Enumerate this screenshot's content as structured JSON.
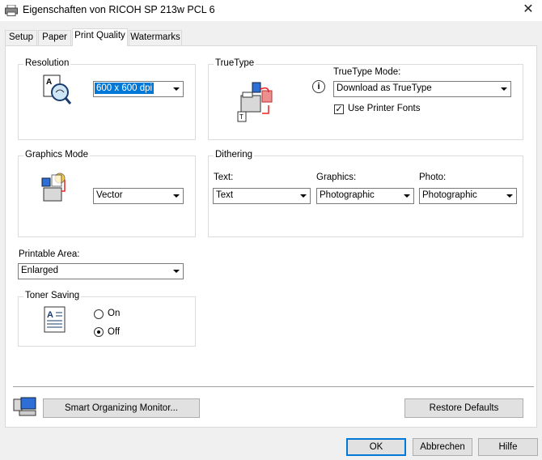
{
  "window": {
    "title": "Eigenschaften von RICOH SP 213w PCL 6",
    "close_glyph": "✕"
  },
  "tabs": [
    {
      "label": "Setup"
    },
    {
      "label": "Paper"
    },
    {
      "label": "Print Quality"
    },
    {
      "label": "Watermarks"
    }
  ],
  "active_tab": "Print Quality",
  "resolution": {
    "legend": "Resolution",
    "value": "600 x 600 dpi"
  },
  "truetype": {
    "legend": "TrueType",
    "mode_label": "TrueType Mode:",
    "mode_value": "Download as TrueType",
    "use_printer_fonts_label": "Use Printer Fonts",
    "use_printer_fonts_checked": true,
    "info_icon": "i"
  },
  "graphics_mode": {
    "legend": "Graphics Mode",
    "value": "Vector"
  },
  "dithering": {
    "legend": "Dithering",
    "text_label": "Text:",
    "text_value": "Text",
    "graphics_label": "Graphics:",
    "graphics_value": "Photographic",
    "photo_label": "Photo:",
    "photo_value": "Photographic"
  },
  "printable_area": {
    "label": "Printable Area:",
    "value": "Enlarged"
  },
  "toner_saving": {
    "legend": "Toner Saving",
    "on_label": "On",
    "off_label": "Off",
    "selected": "Off"
  },
  "buttons": {
    "smart_monitor": "Smart Organizing Monitor...",
    "restore_defaults": "Restore Defaults",
    "ok": "OK",
    "cancel": "Abbrechen",
    "help": "Hilfe"
  },
  "colors": {
    "accent": "#0078d7",
    "highlight_text": "#ffffff"
  }
}
